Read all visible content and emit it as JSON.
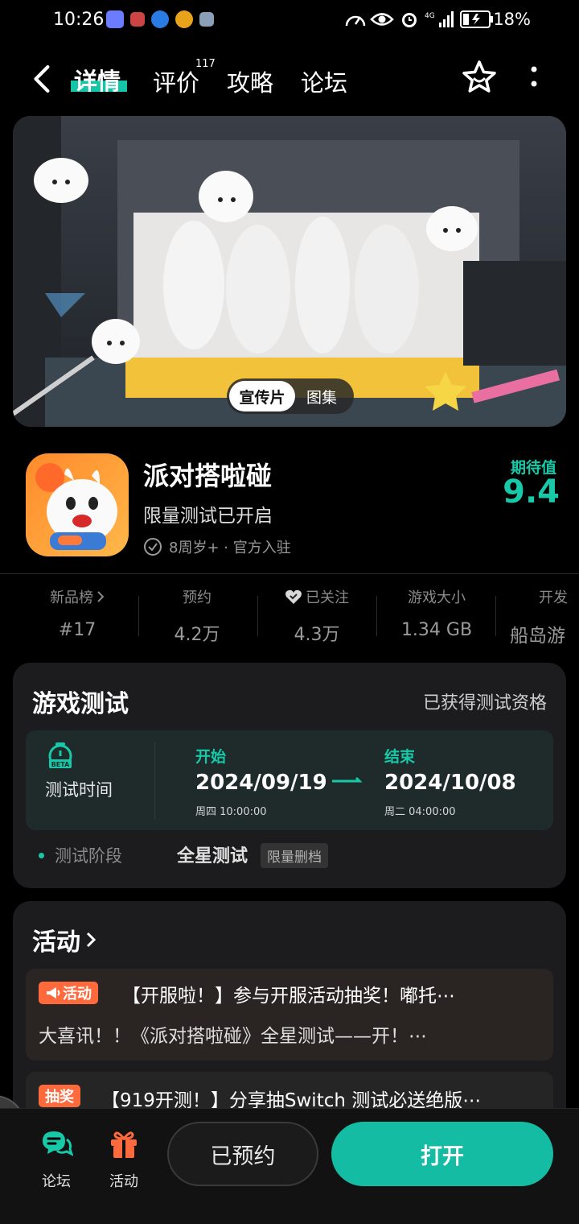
{
  "status_bar": {
    "time": "10:26",
    "battery": "18%"
  },
  "nav": {
    "tabs": [
      {
        "label": "详情"
      },
      {
        "label": "评价"
      },
      {
        "label": "攻略"
      },
      {
        "label": "论坛"
      }
    ],
    "review_count": "117",
    "accent": "#15c5a7"
  },
  "hero": {
    "segments": [
      "宣传片",
      "图集"
    ]
  },
  "game": {
    "title": "派对搭啦碰",
    "subtitle": "限量测试已开启",
    "meta": "8周岁+ · 官方入驻",
    "expect_label": "期待值",
    "expect_score": "9.4"
  },
  "stats": [
    {
      "label": "新品榜",
      "value": "#17"
    },
    {
      "label": "预约",
      "value": "4.2万"
    },
    {
      "label": "已关注",
      "value": "4.3万"
    },
    {
      "label": "游戏大小",
      "value": "1.34 GB"
    },
    {
      "label": "开发",
      "value": "船岛游"
    }
  ],
  "test": {
    "title": "游戏测试",
    "qualification": "已获得测试资格",
    "time_label": "测试时间",
    "start_label": "开始",
    "start_date": "2024/09/19",
    "start_day": "周四   10:00:00",
    "end_label": "结束",
    "end_date": "2024/10/08",
    "end_day": "周二   04:00:00",
    "stage_label": "测试阶段",
    "stage_value": "全星测试",
    "stage_tag": "限量删档"
  },
  "activity": {
    "title": "活动",
    "items": [
      {
        "badge": "活动",
        "title": "【开服啦！】参与开服活动抽奖！嘟托⋯",
        "desc": "大喜讯！！《派对搭啦碰》全星测试——开！⋯"
      },
      {
        "badge": "抽奖",
        "title": "【919开测！】分享抽Switch 测试必送绝版⋯"
      }
    ]
  },
  "bottom": {
    "forum_label": "论坛",
    "activity_label": "活动",
    "reserved_label": "已预约",
    "open_label": "打开"
  }
}
